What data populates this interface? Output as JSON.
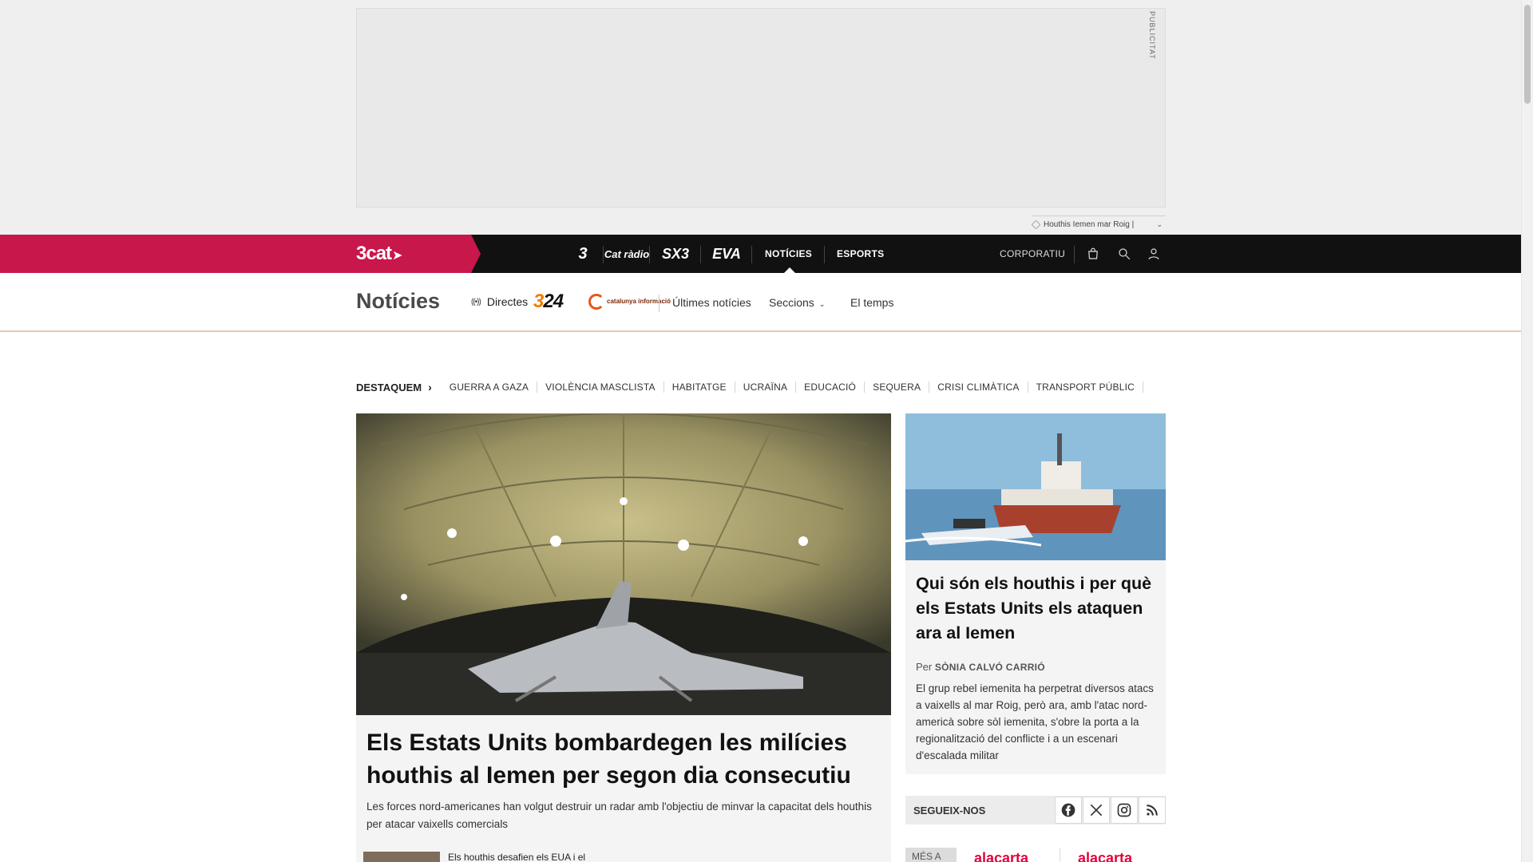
{
  "ad": {
    "label": "PUBLICITAT"
  },
  "tagline": {
    "text": "Houthis Iemen mar Roig |"
  },
  "topbar": {
    "logo": "3cat",
    "channels": {
      "tv3": "3",
      "radio": "Cat ràdio",
      "sx3": "SX3",
      "eva": "EVA"
    },
    "noticies": "NOTÍCIES",
    "esports": "ESPORTS",
    "corporatiu": "CORPORATIU"
  },
  "section": {
    "title": "Notícies",
    "directes": "Directes",
    "logo_324": "324",
    "catinfo": "catalunya informació",
    "links": {
      "ultimes": "Últimes notícies",
      "seccions": "Seccions",
      "temps": "El temps"
    }
  },
  "destaquem": {
    "title": "DESTAQUEM",
    "items": [
      "GUERRA A GAZA",
      "VIOLÈNCIA MASCLISTA",
      "HABITATGE",
      "UCRAÏNA",
      "EDUCACIÓ",
      "SEQUERA",
      "CRISI CLIMÀTICA",
      "TRANSPORT PÚBLIC"
    ]
  },
  "main_article": {
    "headline": "Els Estats Units bombardegen les milícies houthis al Iemen per segon dia consecutiu",
    "lead": "Les forces nord-americanes han volgut destruir un radar amb l'objectiu de minvar la capacitat dels houthis per atacar vaixells comercials",
    "related": "Els houthis desafien els EUA i el"
  },
  "side_article": {
    "headline": "Qui són els houthis i per què els Estats Units els ataquen ara al Iemen",
    "byline_prefix": "Per",
    "author": "SÒNIA CALVÓ CARRIÓ",
    "lead": "El grup rebel iemenita ha perpetrat diversos atacs a vaixells al mar Roig, però ara, amb l'atac nord-americà sobre sòl iemenita, s'obre la porta a la regionalització del conflicte i a un escenari d'escalada militar"
  },
  "follow": {
    "label": "SEGUEIX-NOS"
  },
  "alacarta": {
    "tab1": "MÉS A",
    "tab2": "alacarta",
    "tab3": "alacarta"
  },
  "colors": {
    "brand_red": "#c8174a",
    "topbar": "#111111",
    "orange_324": "#f07d00"
  }
}
